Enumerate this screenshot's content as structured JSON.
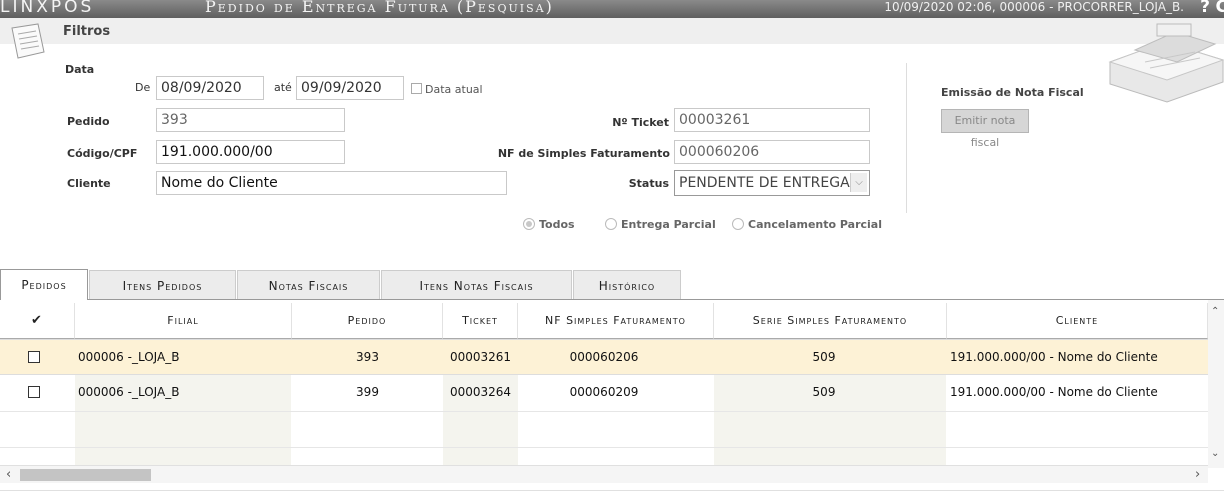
{
  "app": {
    "logo": "LINXPOS",
    "title": "Pedido de Entrega Futura (Pesquisa)",
    "session_info": "10/09/2020 02:06, 000006 - PROCORRER_LOJA_B.",
    "help_label": "?",
    "extra_label": "C"
  },
  "filters": {
    "header": "Filtros",
    "data_label": "Data",
    "de_label": "De",
    "de_value": "08/09/2020",
    "ate_label": "até",
    "ate_value": "09/09/2020",
    "data_atual_label": "Data atual",
    "pedido_label": "Pedido",
    "pedido_value": "393",
    "codigo_label": "Código/CPF",
    "codigo_value": "191.000.000/00",
    "cliente_label": "Cliente",
    "cliente_value": "Nome  do Cliente",
    "ticket_label": "Nº Ticket",
    "ticket_value": "00003261",
    "nf_label": "NF de Simples Faturamento",
    "nf_value": "000060206",
    "status_label": "Status",
    "status_value": "PENDENTE DE ENTREGA",
    "radios": [
      {
        "label": "Todos",
        "selected": true
      },
      {
        "label": "Entrega Parcial",
        "selected": false
      },
      {
        "label": "Cancelamento Parcial",
        "selected": false
      }
    ]
  },
  "nota_fiscal": {
    "label": "Emissão de Nota Fiscal",
    "button": "Emitir nota fiscal"
  },
  "tabs": [
    "Pedidos",
    "Itens Pedidos",
    "Notas Fiscais",
    "Itens Notas Fiscais",
    "Histórico"
  ],
  "grid": {
    "check_header": "✔",
    "columns": [
      "Filial",
      "Pedido",
      "Ticket",
      "NF Simples Faturamento",
      "Serie Simples Faturamento",
      "Cliente"
    ],
    "rows": [
      {
        "filial": "000006 -_LOJA_B",
        "pedido": "393",
        "ticket": "00003261",
        "nf": "000060206",
        "serie": "509",
        "cliente": "191.000.000/00 - Nome  do Cliente"
      },
      {
        "filial": "000006 -_LOJA_B",
        "pedido": "399",
        "ticket": "00003264",
        "nf": "000060209",
        "serie": "509",
        "cliente": "191.000.000/00 - Nome  do Cliente"
      }
    ]
  },
  "scroll": {
    "up": "⌃",
    "down": "⌄",
    "left": "‹",
    "right": "›"
  }
}
